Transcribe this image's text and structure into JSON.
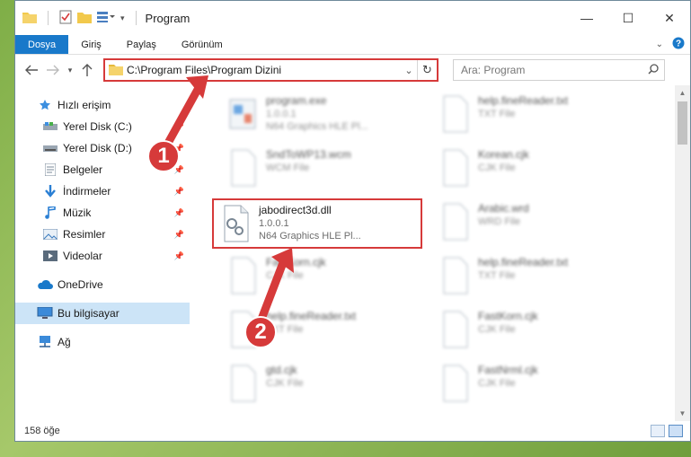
{
  "window": {
    "title": "Program",
    "controls": {
      "minimize": "—",
      "maximize": "☐",
      "close": "✕"
    }
  },
  "ribbon": {
    "tabs": [
      "Dosya",
      "Giriş",
      "Paylaş",
      "Görünüm"
    ],
    "expand_icon": "chevron-down-icon",
    "help_icon": "help-icon"
  },
  "address": {
    "path": "C:\\Program Files\\Program Dizini",
    "search_placeholder": "Ara: Program"
  },
  "nav": {
    "items": [
      {
        "label": "Hızlı erişim",
        "icon": "star-icon",
        "pinned": false
      },
      {
        "label": "Yerel Disk (C:)",
        "icon": "drive-icon",
        "pinned": true
      },
      {
        "label": "Yerel Disk (D:)",
        "icon": "drive-icon",
        "pinned": true
      },
      {
        "label": "Belgeler",
        "icon": "documents-icon",
        "pinned": true
      },
      {
        "label": "İndirmeler",
        "icon": "download-icon",
        "pinned": true
      },
      {
        "label": "Müzik",
        "icon": "music-icon",
        "pinned": true
      },
      {
        "label": "Resimler",
        "icon": "pictures-icon",
        "pinned": true
      },
      {
        "label": "Videolar",
        "icon": "videos-icon",
        "pinned": true
      },
      {
        "label": "OneDrive",
        "icon": "cloud-icon",
        "pinned": false
      },
      {
        "label": "Bu bilgisayar",
        "icon": "computer-icon",
        "pinned": false
      },
      {
        "label": "Ağ",
        "icon": "network-icon",
        "pinned": false
      }
    ]
  },
  "files": [
    {
      "name": "program.exe",
      "line1": "1.0.0.1",
      "line2": "N64 Graphics HLE Pl...",
      "kind": "exe"
    },
    {
      "name": "help.fineReader.txt",
      "line1": "TXT File",
      "line2": "",
      "kind": "doc"
    },
    {
      "name": "SndToWP13.wcm",
      "line1": "WCM File",
      "line2": "",
      "kind": "doc"
    },
    {
      "name": "Korean.cjk",
      "line1": "CJK File",
      "line2": "",
      "kind": "doc"
    },
    {
      "name": "jabodirect3d.dll",
      "line1": "1.0.0.1",
      "line2": "N64 Graphics HLE Pl...",
      "kind": "dll"
    },
    {
      "name": "Arabic.wrd",
      "line1": "WRD File",
      "line2": "",
      "kind": "doc"
    },
    {
      "name": "FastKorn.cjk",
      "line1": "CJK File",
      "line2": "",
      "kind": "doc"
    },
    {
      "name": "help.fineReader.txt",
      "line1": "TXT File",
      "line2": "",
      "kind": "doc"
    },
    {
      "name": "help.fineReader.txt",
      "line1": "TXT File",
      "line2": "",
      "kind": "doc"
    },
    {
      "name": "FastKorn.cjk",
      "line1": "CJK File",
      "line2": "",
      "kind": "doc"
    },
    {
      "name": "gtd.cjk",
      "line1": "CJK File",
      "line2": "",
      "kind": "doc"
    },
    {
      "name": "FastNrml.cjk",
      "line1": "CJK File",
      "line2": "",
      "kind": "doc"
    }
  ],
  "status": {
    "count": "158 öğe"
  },
  "annotations": {
    "step1": "1",
    "step2": "2"
  },
  "colors": {
    "accent": "#1979ca",
    "highlight": "#d63a3a",
    "selected": "#cce4f7"
  }
}
